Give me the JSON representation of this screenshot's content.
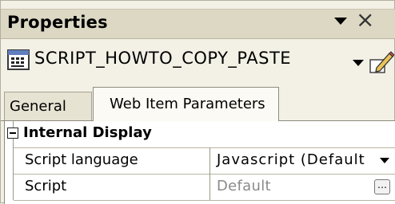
{
  "panel": {
    "title": "Properties",
    "title_dropdown_icon": "chevron-down-icon",
    "close_icon": "close-icon"
  },
  "object_selector": {
    "icon": "script-item-icon",
    "name": "SCRIPT_HOWTO_COPY_PASTE",
    "dropdown_icon": "chevron-down-icon",
    "edit_icon": "pencil-icon"
  },
  "tabs": [
    {
      "label": "General",
      "active": false
    },
    {
      "label": "Web Item Parameters",
      "active": true
    }
  ],
  "grid": {
    "category": {
      "label": "Internal Display",
      "expanded": true,
      "toggle_icon": "minus-box-icon"
    },
    "rows": [
      {
        "name": "Script language",
        "value": "Javascript (Default",
        "control": "dropdown"
      },
      {
        "name": "Script",
        "value": "Default",
        "control": "ellipsis",
        "ellipsis_label": "…"
      }
    ]
  },
  "colors": {
    "titlebar": "#dcd8c4",
    "panel_bg": "#f3f1e6",
    "active_tab": "#fbfaf4",
    "grid_bg": "#ffffff",
    "muted_text": "#8a8a8a"
  }
}
